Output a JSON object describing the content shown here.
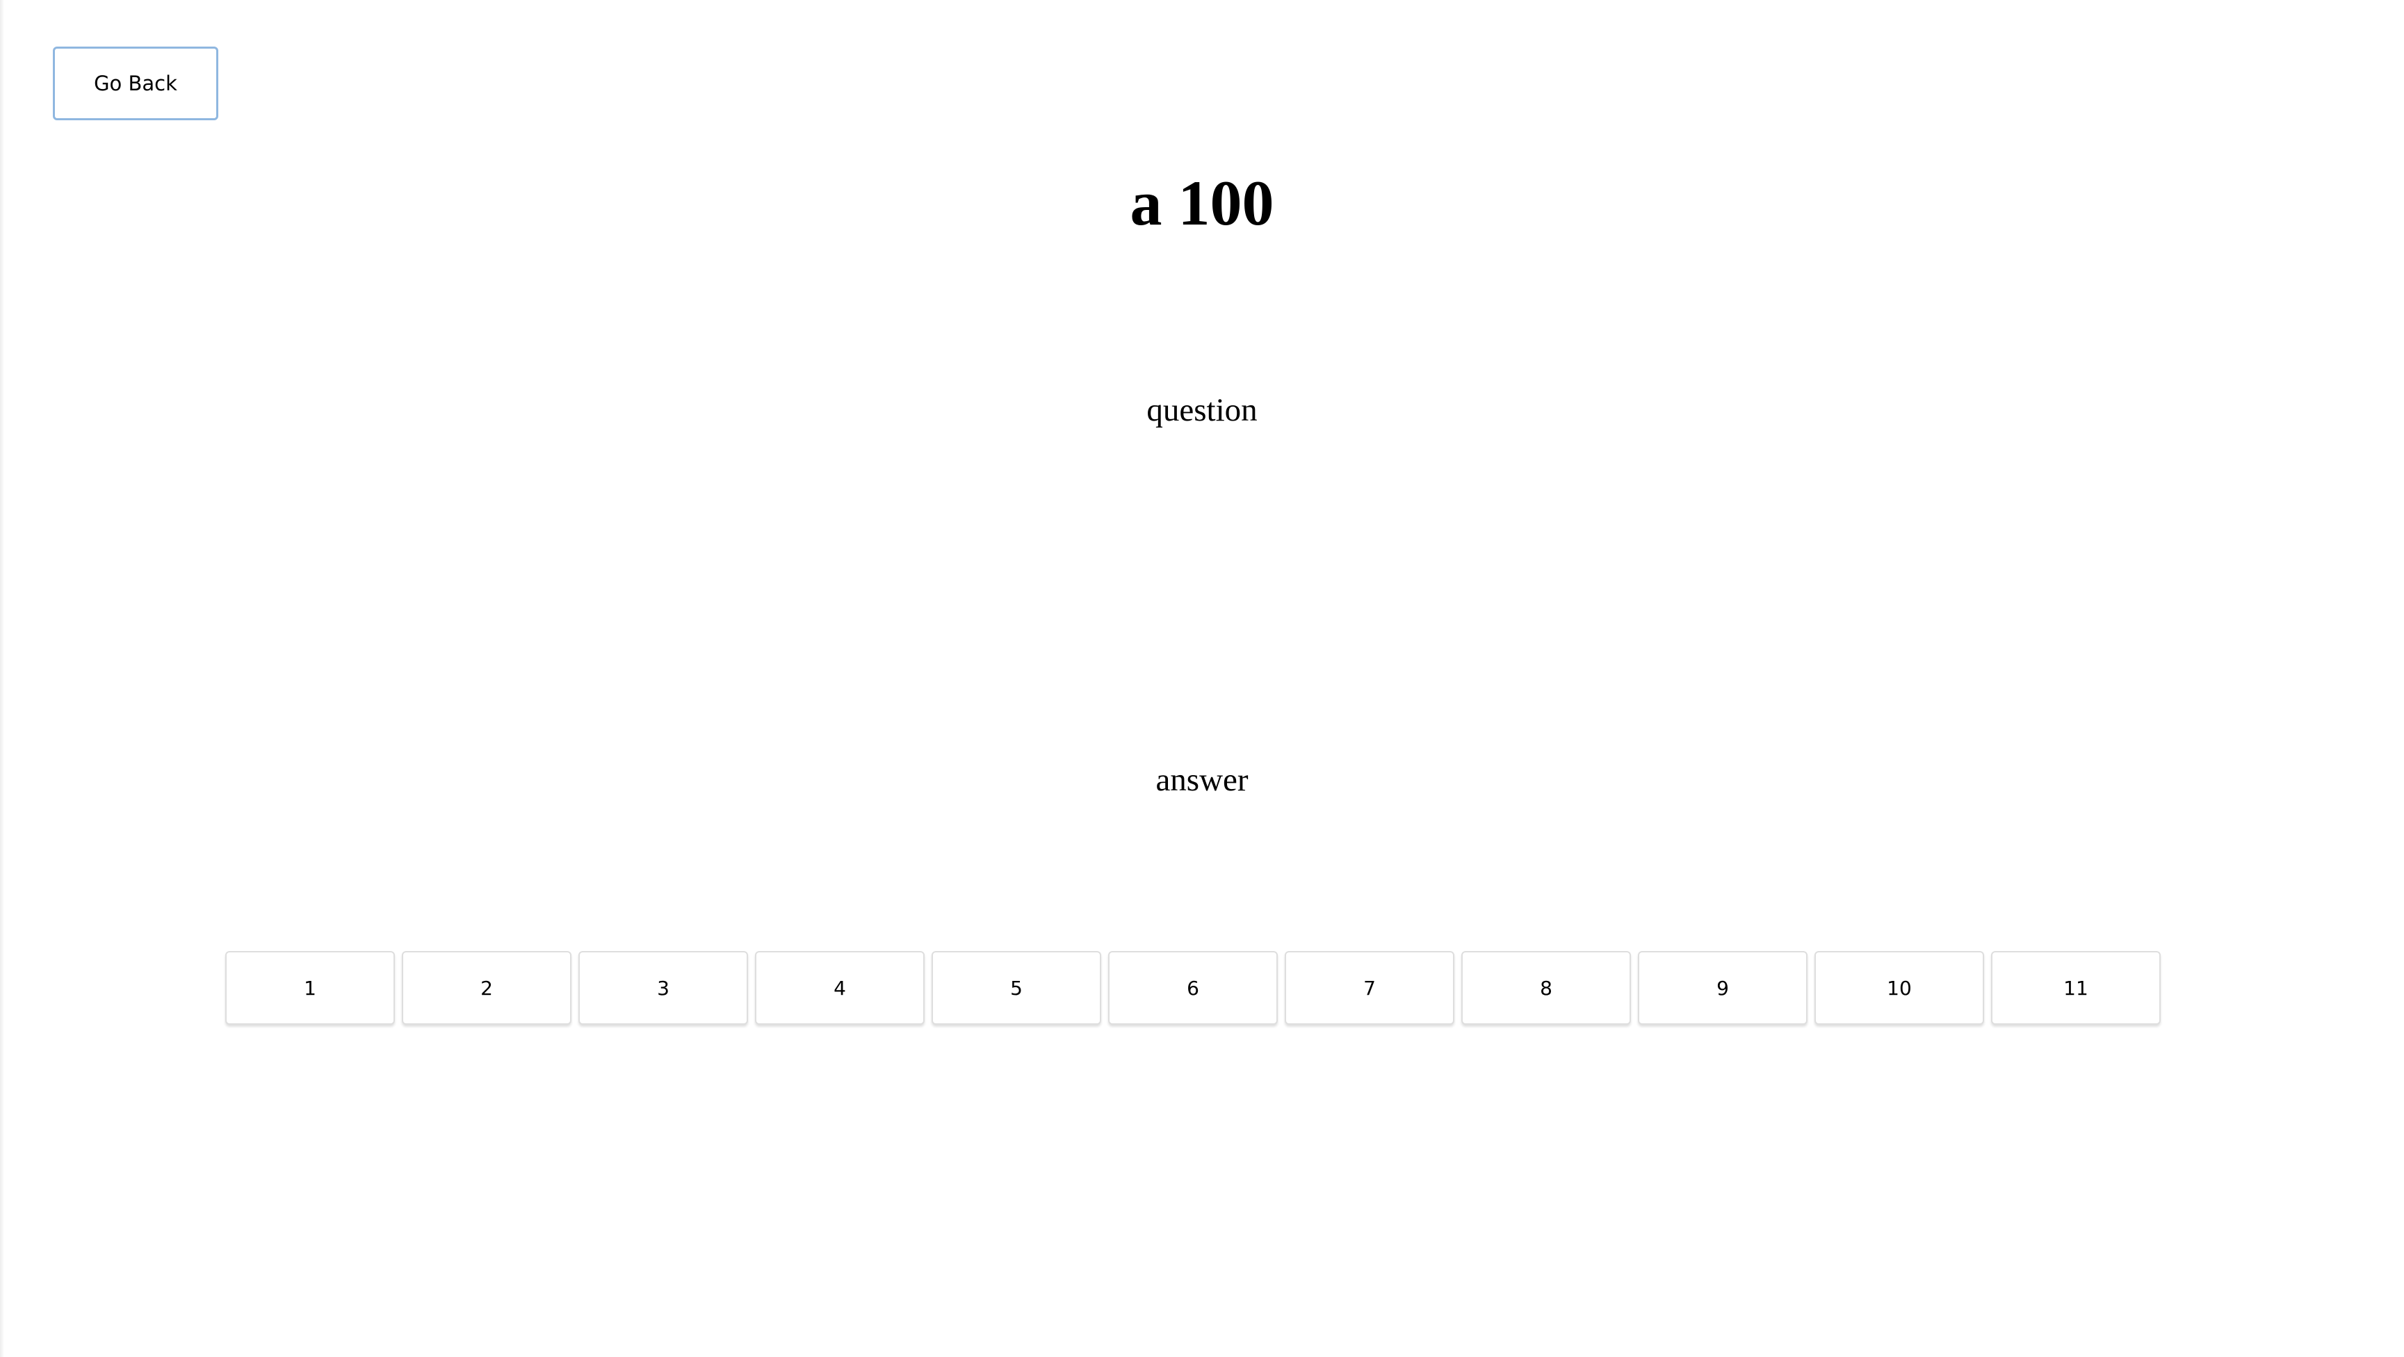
{
  "header": {
    "go_back_label": "Go Back"
  },
  "main": {
    "title": "a 100",
    "question": "question",
    "answer": "answer"
  },
  "number_buttons": [
    "1",
    "2",
    "3",
    "4",
    "5",
    "6",
    "7",
    "8",
    "9",
    "10",
    "11"
  ],
  "colors": {
    "go_back_border": "#8fb7e0",
    "button_border": "#dedede",
    "background": "#ffffff"
  }
}
